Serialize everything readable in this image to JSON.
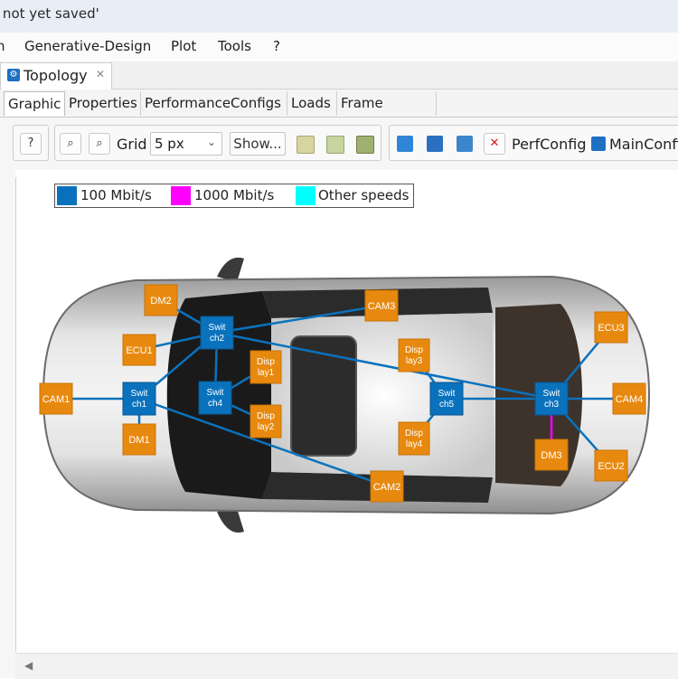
{
  "window": {
    "title": "l not yet saved'"
  },
  "menu": {
    "items": [
      "n",
      "Generative-Design",
      "Plot",
      "Tools",
      "?"
    ]
  },
  "view_tab": {
    "label": "Topology",
    "close": "✕"
  },
  "subtabs": [
    "Graphic",
    "Properties",
    "PerformanceConfigs",
    "Loads",
    "Frame Losses"
  ],
  "toolbar": {
    "help": "?",
    "grid_label": "Grid",
    "grid_value": "5 px",
    "show_label": "Show...",
    "perfconfig_label": "PerfConfig",
    "config_value": "MainConfig",
    "delete_glyph": "✕"
  },
  "legend": [
    {
      "label": "100 Mbit/s",
      "color": "#0a72bd"
    },
    {
      "label": "1000 Mbit/s",
      "color": "#ff00ff"
    },
    {
      "label": "Other speeds",
      "color": "#00ffff"
    }
  ],
  "topology": {
    "switches": [
      {
        "id": "sw1",
        "line1": "Swit",
        "line2": "ch1"
      },
      {
        "id": "sw2",
        "line1": "Swit",
        "line2": "ch2"
      },
      {
        "id": "sw4",
        "line1": "Swit",
        "line2": "ch4"
      },
      {
        "id": "sw5",
        "line1": "Swit",
        "line2": "ch5"
      },
      {
        "id": "sw3",
        "line1": "Swit",
        "line2": "ch3"
      }
    ],
    "devices": [
      {
        "id": "dm2",
        "line1": "DM2",
        "line2": ""
      },
      {
        "id": "ecu1",
        "line1": "ECU1",
        "line2": ""
      },
      {
        "id": "cam1",
        "line1": "CAM1",
        "line2": ""
      },
      {
        "id": "dm1",
        "line1": "DM1",
        "line2": ""
      },
      {
        "id": "disp1",
        "line1": "Disp",
        "line2": "lay1"
      },
      {
        "id": "disp2",
        "line1": "Disp",
        "line2": "lay2"
      },
      {
        "id": "cam3",
        "line1": "CAM3",
        "line2": ""
      },
      {
        "id": "disp3",
        "line1": "Disp",
        "line2": "lay3"
      },
      {
        "id": "disp4",
        "line1": "Disp",
        "line2": "lay4"
      },
      {
        "id": "cam2",
        "line1": "CAM2",
        "line2": ""
      },
      {
        "id": "ecu3",
        "line1": "ECU3",
        "line2": ""
      },
      {
        "id": "cam4",
        "line1": "CAM4",
        "line2": ""
      },
      {
        "id": "dm3",
        "line1": "DM3",
        "line2": ""
      },
      {
        "id": "ecu2",
        "line1": "ECU2",
        "line2": ""
      }
    ],
    "links": [
      {
        "from": "cam1",
        "to": "sw1",
        "speed": "100 Mbit/s"
      },
      {
        "from": "ecu1",
        "to": "sw2",
        "speed": "100 Mbit/s"
      },
      {
        "from": "dm2",
        "to": "sw2",
        "speed": "100 Mbit/s"
      },
      {
        "from": "sw2",
        "to": "sw1",
        "speed": "100 Mbit/s"
      },
      {
        "from": "sw1",
        "to": "dm1",
        "speed": "100 Mbit/s"
      },
      {
        "from": "sw2",
        "to": "sw4",
        "speed": "100 Mbit/s"
      },
      {
        "from": "sw4",
        "to": "disp1",
        "speed": "100 Mbit/s"
      },
      {
        "from": "sw4",
        "to": "disp2",
        "speed": "100 Mbit/s"
      },
      {
        "from": "sw2",
        "to": "cam3",
        "speed": "100 Mbit/s"
      },
      {
        "from": "sw2",
        "to": "sw3",
        "speed": "100 Mbit/s"
      },
      {
        "from": "sw1",
        "to": "cam2",
        "speed": "100 Mbit/s"
      },
      {
        "from": "sw5",
        "to": "disp3",
        "speed": "100 Mbit/s"
      },
      {
        "from": "sw5",
        "to": "disp4",
        "speed": "100 Mbit/s"
      },
      {
        "from": "sw5",
        "to": "sw3",
        "speed": "100 Mbit/s"
      },
      {
        "from": "sw3",
        "to": "ecu3",
        "speed": "100 Mbit/s"
      },
      {
        "from": "sw3",
        "to": "cam4",
        "speed": "100 Mbit/s"
      },
      {
        "from": "sw3",
        "to": "ecu2",
        "speed": "100 Mbit/s"
      },
      {
        "from": "sw3",
        "to": "dm3",
        "speed": "1000 Mbit/s"
      }
    ]
  }
}
